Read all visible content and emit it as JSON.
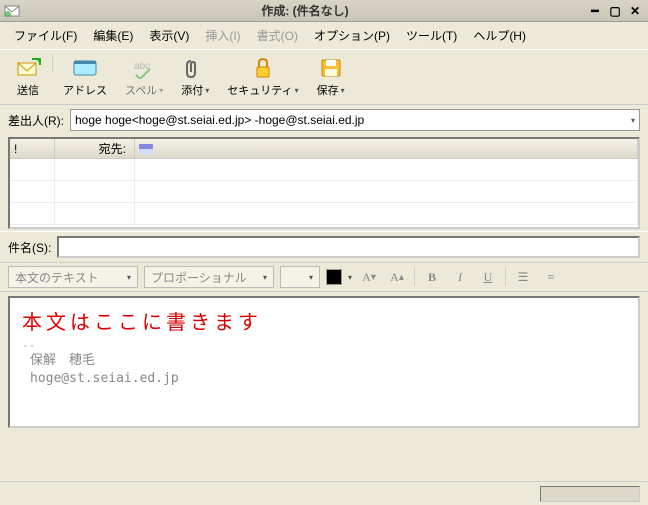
{
  "title": "作成: (件名なし)",
  "menu": {
    "file": "ファイル(F)",
    "edit": "編集(E)",
    "view": "表示(V)",
    "insert": "挿入(I)",
    "format": "書式(O)",
    "options": "オプション(P)",
    "tools": "ツール(T)",
    "help": "ヘルプ(H)"
  },
  "toolbar": {
    "send": "送信",
    "address": "アドレス",
    "spell": "スペル",
    "attach": "添付",
    "security": "セキュリティ",
    "save": "保存"
  },
  "from": {
    "label": "差出人(R):",
    "value": "hoge hoge<hoge@st.seiai.ed.jp>  -hoge@st.seiai.ed.jp"
  },
  "recipients": {
    "header_type": "宛先:",
    "priority_mark": "!"
  },
  "subject": {
    "label": "件名(S):",
    "value": ""
  },
  "format": {
    "style": "本文のテキスト",
    "font": "プロポーショナル",
    "size": ""
  },
  "body": {
    "annotation": "本文はここに書きます",
    "dash": "--",
    "sig_name": "保解　穂毛",
    "sig_email": "hoge@st.seiai.ed.jp"
  }
}
